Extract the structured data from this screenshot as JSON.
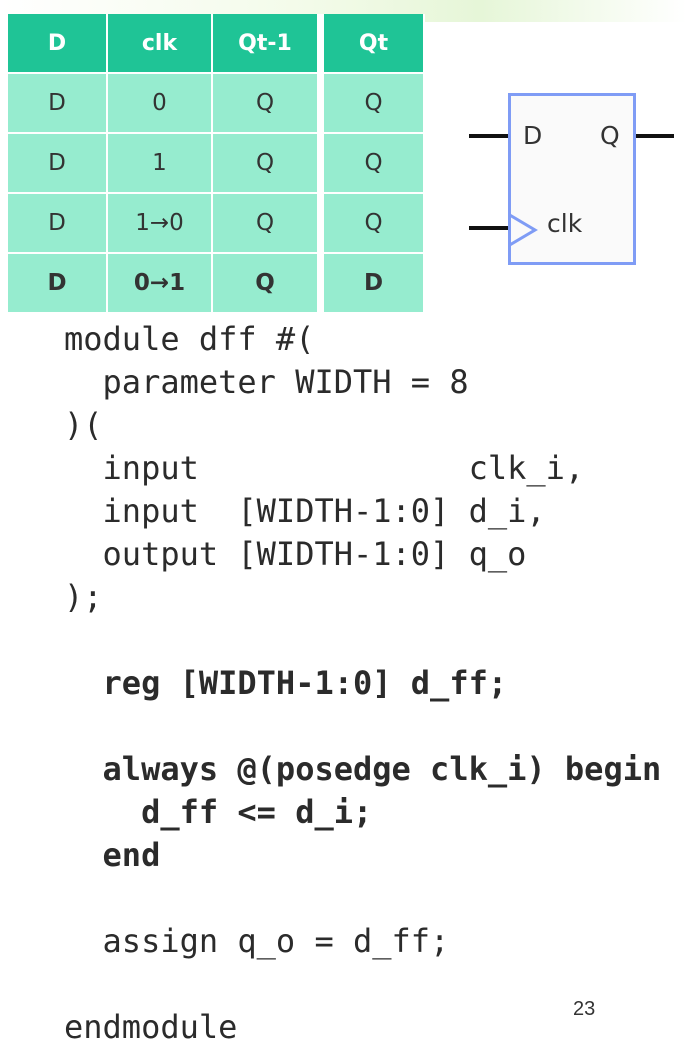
{
  "truth_table": {
    "headers": [
      "D",
      "clk",
      "Qt-1",
      "Qt"
    ],
    "rows": [
      [
        "D",
        "0",
        "Q",
        "Q"
      ],
      [
        "D",
        "1",
        "Q",
        "Q"
      ],
      [
        "D",
        "1→0",
        "Q",
        "Q"
      ],
      [
        "D",
        "0→1",
        "Q",
        "D"
      ]
    ]
  },
  "flipflop": {
    "d_label": "D",
    "q_label": "Q",
    "clk_label": "clk"
  },
  "code": {
    "lines": [
      "module dff #(",
      "  parameter WIDTH = 8",
      ")(",
      "  input              clk_i,",
      "  input  [WIDTH-1:0] d_i,",
      "  output [WIDTH-1:0] q_o",
      ");",
      "",
      "  reg [WIDTH-1:0] d_ff;",
      "",
      "  always @(posedge clk_i) begin",
      "    d_ff <= d_i;",
      "  end",
      "",
      "  assign q_o = d_ff;",
      "",
      "endmodule"
    ]
  },
  "page_number": "23",
  "colors": {
    "header_bg": "#1fc496",
    "cell_bg": "#96eccf",
    "block_border": "#7f9cf5"
  }
}
